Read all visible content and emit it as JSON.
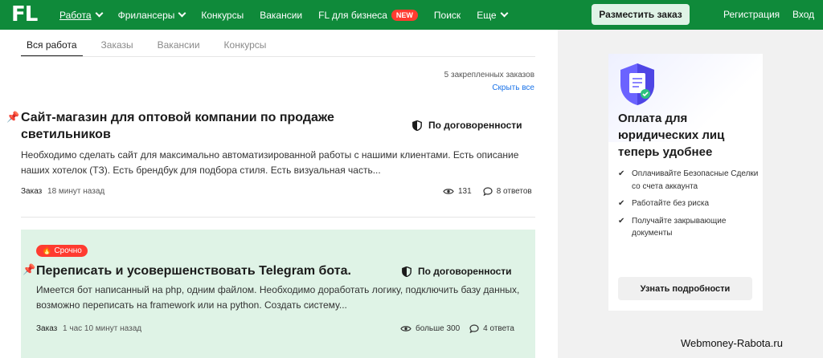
{
  "header": {
    "logo": "FL",
    "nav": [
      {
        "label": "Работа",
        "chevron": true,
        "active": true
      },
      {
        "label": "Фрилансеры",
        "chevron": true
      },
      {
        "label": "Конкурсы"
      },
      {
        "label": "Вакансии"
      },
      {
        "label": "FL для бизнеса",
        "badge": "NEW"
      },
      {
        "label": "Поиск"
      },
      {
        "label": "Еще",
        "chevron": true
      }
    ],
    "place_order": "Разместить заказ",
    "register": "Регистрация",
    "login": "Вход"
  },
  "tabs": [
    "Вся работа",
    "Заказы",
    "Вакансии",
    "Конкурсы"
  ],
  "pinned": {
    "count_text": "5 закрепленных заказов",
    "hide_all": "Скрыть все"
  },
  "jobs": [
    {
      "title": "Сайт-магазин для оптовой компании по продаже светильников",
      "price": "По договоренности",
      "description": "Необходимо сделать сайт для максимально автоматизированной работы с нашими клиентами.  Есть описание наших хотелок (ТЗ). Есть брендбук для подбора стиля. Есть визуальная часть...",
      "type": "Заказ",
      "time": "18 минут назад",
      "views": "131",
      "answers": "8 ответов"
    },
    {
      "badge": "Срочно",
      "title": "Переписать и усовершенствовать Telegram бота.",
      "price": "По договоренности",
      "description": "Имеется бот написанный на php, одним файлом.  Необходимо доработать логику, подключить базу данных, возможно переписать на framework или на python. Создать систему...",
      "type": "Заказ",
      "time": "1 час 10 минут назад",
      "views": "больше 300",
      "answers": "4 ответа"
    }
  ],
  "promo": {
    "title": "Оплата для юридических лиц теперь удобнее",
    "items": [
      "Оплачивайте Безопасные Сделки со счета аккаунта",
      "Работайте без риска",
      "Получайте закрывающие документы"
    ],
    "button": "Узнать подробности"
  },
  "watermark": "Webmoney-Rabota.ru",
  "colors": {
    "brand_green": "#0f8a3a",
    "urgent_red": "#ff3b30",
    "urgent_bg": "#dff3e6",
    "link_blue": "#1a73e8"
  }
}
